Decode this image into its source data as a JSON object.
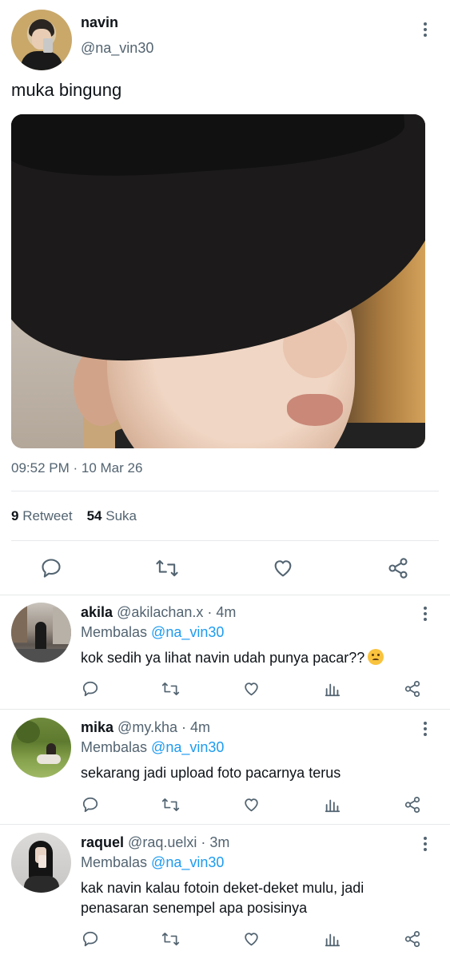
{
  "tweet": {
    "author_name": "navin",
    "author_handle": "@na_vin30",
    "text": "muka bingung",
    "timestamp": "09:52 PM · 10 Mar 26",
    "retweet_count": "9",
    "retweet_label": "Retweet",
    "like_count": "54",
    "like_label": "Suka"
  },
  "replies": [
    {
      "name": "akila",
      "handle": "@akilachan.x",
      "time": "· 4m",
      "replying_label": "Membalas",
      "replying_to": "@na_vin30",
      "text": "kok sedih ya lihat navin udah punya pacar??"
    },
    {
      "name": "mika",
      "handle": "@my.kha",
      "time": "· 4m",
      "replying_label": "Membalas",
      "replying_to": "@na_vin30",
      "text": "sekarang jadi upload foto pacarnya terus"
    },
    {
      "name": "raquel",
      "handle": "@raq.uelxi",
      "time": "· 3m",
      "replying_label": "Membalas",
      "replying_to": "@na_vin30",
      "text": "kak navin kalau fotoin deket-deket mulu, jadi penasaran senempel apa posisinya"
    }
  ],
  "icons": [
    "more-vertical-icon",
    "reply-icon",
    "retweet-icon",
    "like-icon",
    "share-icon",
    "analytics-icon",
    "frowning-emoji"
  ],
  "colors": {
    "accent": "#1d9bf0",
    "secondary_text": "#536471",
    "divider": "#e6e9ea"
  }
}
